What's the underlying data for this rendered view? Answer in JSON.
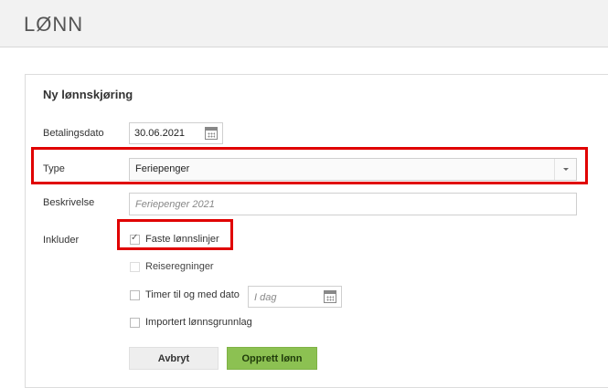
{
  "header": {
    "title": "LØNN"
  },
  "form": {
    "title": "Ny lønnskjøring",
    "payment_date": {
      "label": "Betalingsdato",
      "value": "30.06.2021"
    },
    "type": {
      "label": "Type",
      "value": "Feriepenger"
    },
    "description": {
      "label": "Beskrivelse",
      "placeholder": "Feriepenger 2021"
    },
    "include": {
      "label": "Inkluder",
      "options": [
        {
          "label": "Faste lønnslinjer",
          "checked": true
        },
        {
          "label": "Reiseregninger",
          "checked": false,
          "disabled": true
        },
        {
          "label": "Timer til og med dato",
          "checked": false
        },
        {
          "label": "Importert lønnsgrunnlag",
          "checked": false
        }
      ],
      "hours_date_placeholder": "I dag"
    },
    "buttons": {
      "cancel": "Avbryt",
      "submit": "Opprett lønn"
    }
  },
  "colors": {
    "primary_button": "#8cc152",
    "highlight": "#e00000",
    "header_bg": "#f2f2f2"
  },
  "icons": {
    "date_picker": "calendar-icon",
    "select": "chevron-down-icon",
    "checkbox": "check-icon"
  }
}
